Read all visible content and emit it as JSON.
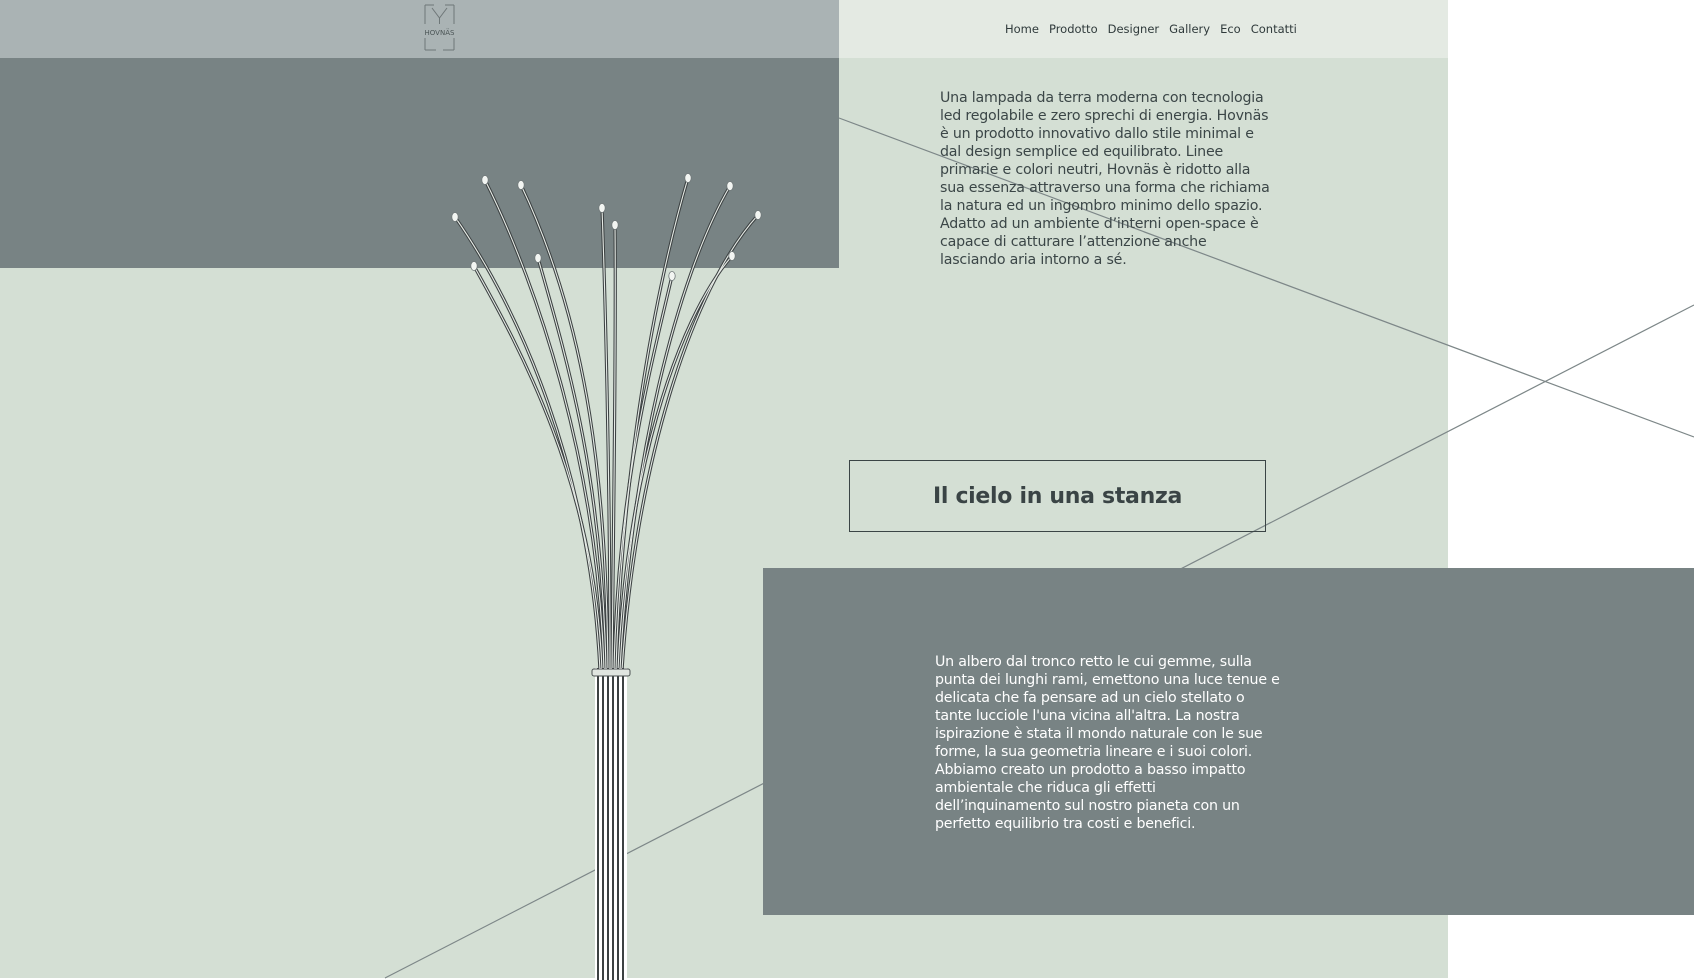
{
  "brand": {
    "logo_text": "HOVNÄS"
  },
  "nav": {
    "items": [
      {
        "label": "Home"
      },
      {
        "label": "Prodotto"
      },
      {
        "label": "Designer"
      },
      {
        "label": "Gallery"
      },
      {
        "label": "Eco"
      },
      {
        "label": "Contatti"
      }
    ]
  },
  "intro": {
    "text": "Una lampada da terra moderna con tecnologia led regolabile e zero sprechi di energia. Hovnäs è un prodotto innovativo dallo stile minimal e dal design semplice ed equilibrato. Linee primarie e colori neutri, Hovnäs è ridotto alla sua essenza attraverso una forma che richiama la natura ed un ingombro minimo dello spazio. Adatto ad un ambiente d’interni open-space è capace di catturare l’attenzione anche lasciando aria intorno a sé."
  },
  "slogan": {
    "title": "Il cielo in una stanza"
  },
  "concept": {
    "text": "Un albero dal tronco retto le cui gemme, sulla punta dei lunghi rami, emettono una luce tenue e delicata che fa pensare ad un cielo stellato o tante lucciole l'una vicina all'altra. La nostra ispirazione è stata il mondo naturale con le sue forme, la sua geometria lineare e i suoi colori. Abbiamo creato un prodotto a basso impatto ambientale che riduca gli effetti dell’inquinamento sul nostro pianeta con un perfetto equilibrio tra costi e benefici."
  },
  "colors": {
    "sage_background": "#d4dfd4",
    "slate_panel": "#788384",
    "header_grey": "#aab3b4",
    "header_light": "#e4eae3",
    "text_dark": "#3b4647"
  }
}
